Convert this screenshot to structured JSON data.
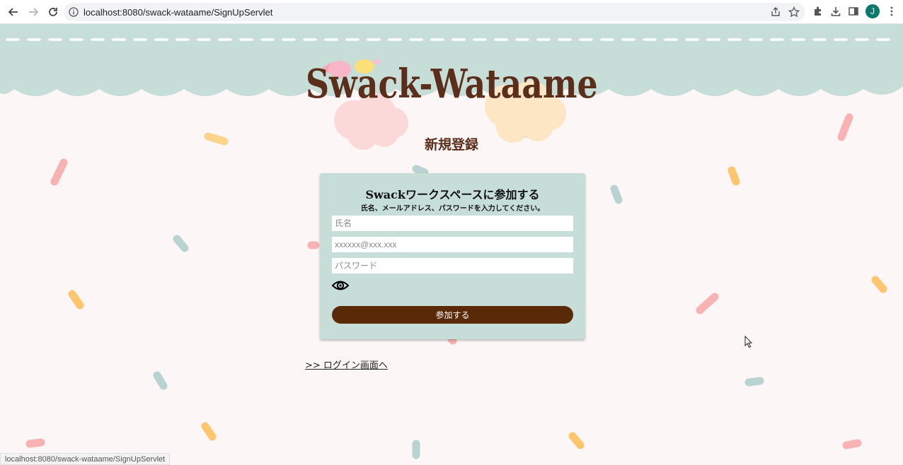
{
  "browser": {
    "url": "localhost:8080/swack-wataame/SignUpServlet",
    "profile_initial": "J",
    "status_url": "localhost:8080/swack-wataame/SignUpServlet"
  },
  "header": {
    "logo_text": "Swack-Wataame",
    "page_title": "新規登録"
  },
  "form": {
    "title": "Swackワークスペースに参加する",
    "subtitle": "氏名、メールアドレス、パスワードを入力してください。",
    "name_placeholder": "氏名",
    "email_placeholder": "xxxxxx@xxx.xxx",
    "password_placeholder": "パスワード",
    "submit_label": "参加する"
  },
  "links": {
    "login_label": ">> ログイン画面へ"
  },
  "colors": {
    "scallop": "#c7ddd8",
    "brown": "#5a2e1a",
    "button": "#5a2a08",
    "background": "#fdf6f6"
  }
}
